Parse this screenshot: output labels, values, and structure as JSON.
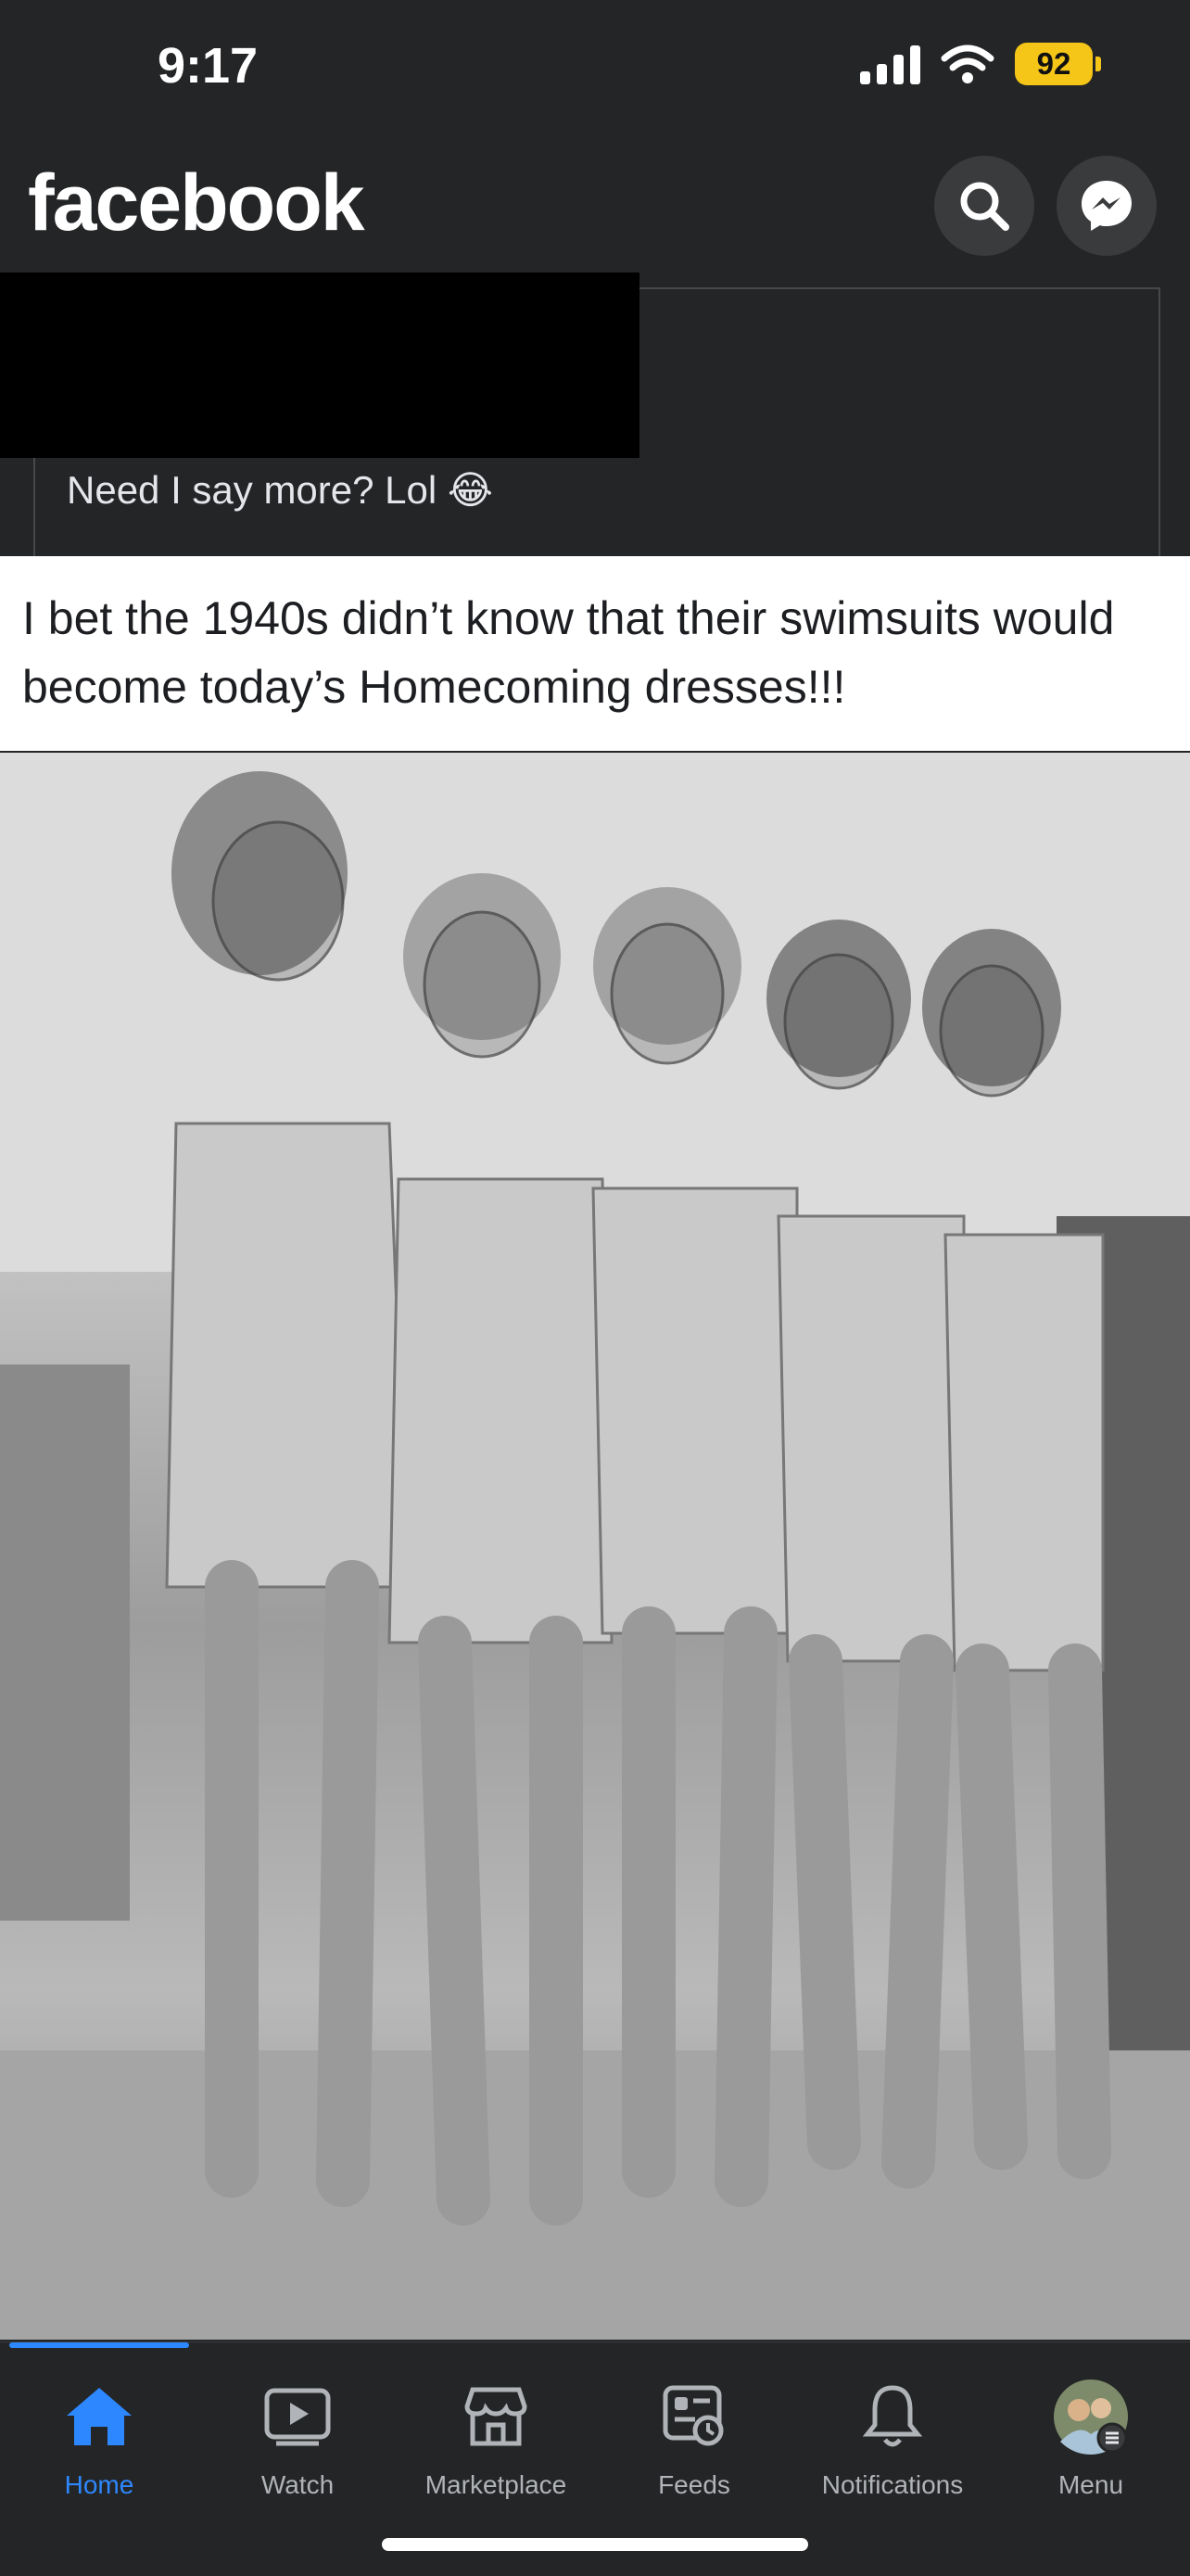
{
  "status_bar": {
    "time": "9:17",
    "battery": "92"
  },
  "header": {
    "logo": "facebook",
    "search_icon": "search-icon",
    "messenger_icon": "messenger-icon"
  },
  "post": {
    "caption": "Need I say more? Lol",
    "caption_emoji": "😂",
    "meme_text": "I bet the 1940s didn’t know that their swimsuits would become today’s Homecoming dresses!!!"
  },
  "bottom_nav": {
    "items": [
      {
        "label": "Home",
        "icon": "home-icon",
        "active": true
      },
      {
        "label": "Watch",
        "icon": "watch-icon"
      },
      {
        "label": "Marketplace",
        "icon": "marketplace-icon"
      },
      {
        "label": "Feeds",
        "icon": "feeds-icon"
      },
      {
        "label": "Notifications",
        "icon": "bell-icon"
      },
      {
        "label": "Menu",
        "icon": "avatar-icon"
      }
    ]
  },
  "colors": {
    "accent": "#2d88ff",
    "background": "#242526",
    "battery": "#f5c518"
  }
}
